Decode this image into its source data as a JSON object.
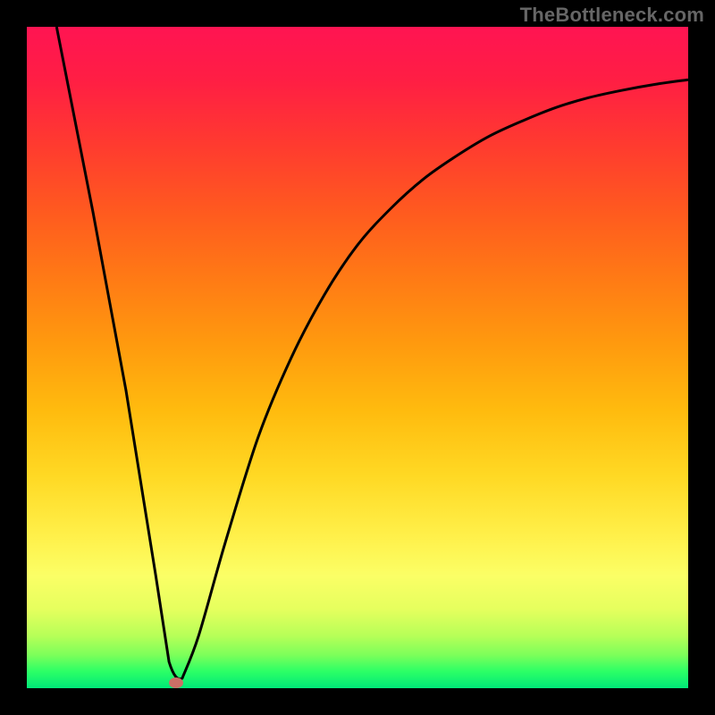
{
  "watermark": "TheBottleneck.com",
  "marker": {
    "color": "#cc6f66",
    "x_frac": 0.225,
    "y_frac": 0.992
  },
  "curve": {
    "stroke": "#000000",
    "stroke_width": 3
  },
  "chart_data": {
    "type": "line",
    "title": "",
    "xlabel": "",
    "ylabel": "",
    "xlim": [
      0,
      1
    ],
    "ylim": [
      0,
      1
    ],
    "annotations": [
      "TheBottleneck.com"
    ],
    "series": [
      {
        "name": "bottleneck-curve",
        "x": [
          0.045,
          0.1,
          0.15,
          0.195,
          0.215,
          0.225,
          0.235,
          0.26,
          0.3,
          0.35,
          0.4,
          0.45,
          0.5,
          0.55,
          0.6,
          0.65,
          0.7,
          0.75,
          0.8,
          0.85,
          0.9,
          0.95,
          1.0
        ],
        "y": [
          1.0,
          0.72,
          0.45,
          0.17,
          0.04,
          0.008,
          0.015,
          0.08,
          0.22,
          0.38,
          0.5,
          0.595,
          0.67,
          0.725,
          0.77,
          0.805,
          0.835,
          0.858,
          0.878,
          0.893,
          0.904,
          0.913,
          0.92
        ]
      }
    ],
    "marker_point": {
      "x": 0.225,
      "y": 0.008
    }
  }
}
